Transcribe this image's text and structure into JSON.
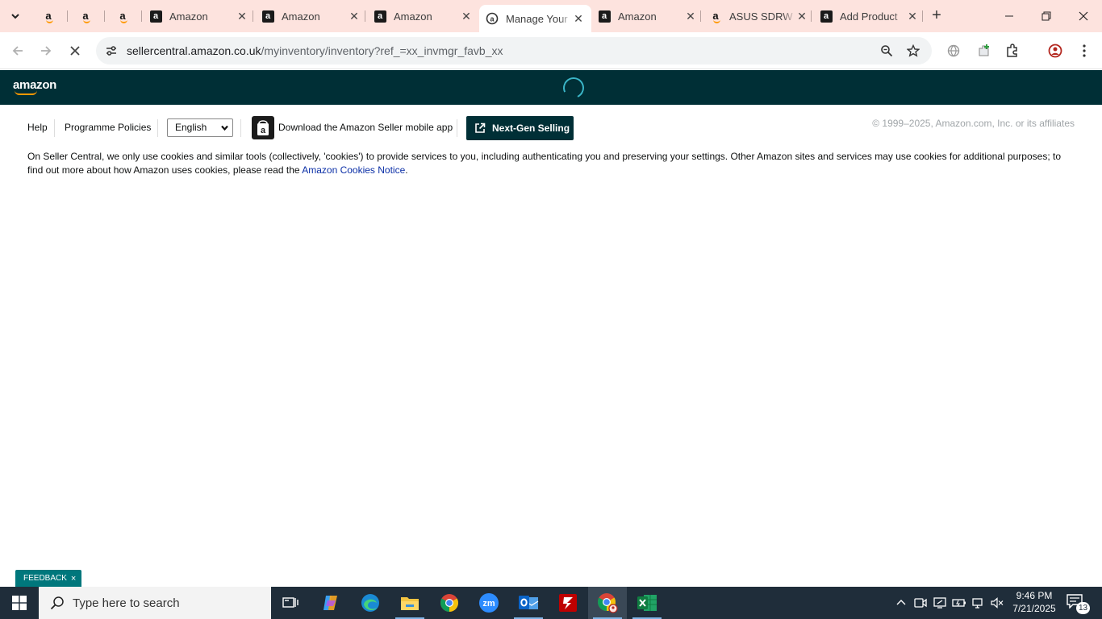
{
  "browser": {
    "tabs": [
      {
        "type": "pinned",
        "icon": "amazon-a-icon"
      },
      {
        "type": "pinned",
        "icon": "amazon-a-icon"
      },
      {
        "type": "pinned",
        "icon": "amazon-a-icon"
      },
      {
        "type": "normal",
        "title": "Amazon",
        "icon": "amazon-box-icon"
      },
      {
        "type": "normal",
        "title": "Amazon",
        "icon": "amazon-box-icon"
      },
      {
        "type": "normal",
        "title": "Amazon",
        "icon": "amazon-box-icon"
      },
      {
        "type": "active",
        "title": "Manage Your",
        "icon": "seller-central-icon"
      },
      {
        "type": "normal",
        "title": "Amazon",
        "icon": "amazon-box-icon"
      },
      {
        "type": "normal",
        "title": "ASUS SDRW",
        "icon": "amazon-a-icon"
      },
      {
        "type": "normal",
        "title": "Add Product",
        "icon": "amazon-box-icon"
      }
    ],
    "url_host": "sellercentral.amazon.co.uk",
    "url_path": "/myinventory/inventory?ref_=xx_invmgr_favb_xx"
  },
  "header": {
    "logo_text": "amazon"
  },
  "footer": {
    "help": "Help",
    "policies": "Programme Policies",
    "language": "English",
    "app_download": "Download the Amazon Seller mobile app",
    "nextgen": "Next-Gen Selling",
    "copyright": "© 1999–2025, Amazon.com, Inc. or its affiliates",
    "cookie_text": "On Seller Central, we only use cookies and similar tools (collectively, 'cookies') to provide services to you, including authenticating you and preserving your settings. Other Amazon sites and services may use cookies for additional purposes; to find out more about how Amazon uses cookies, please read the ",
    "cookie_link": "Amazon Cookies Notice",
    "cookie_end": "."
  },
  "feedback": {
    "label": "FEEDBACK",
    "close": "×"
  },
  "taskbar": {
    "search_placeholder": "Type here to search",
    "time": "9:46 PM",
    "date": "7/21/2025",
    "notification_count": "13"
  },
  "colors": {
    "tabstrip": "#fde3de",
    "amazon_header": "#002f36",
    "feedback": "#00777c",
    "taskbar": "#1f2d3a",
    "link": "#0a2ea6"
  }
}
